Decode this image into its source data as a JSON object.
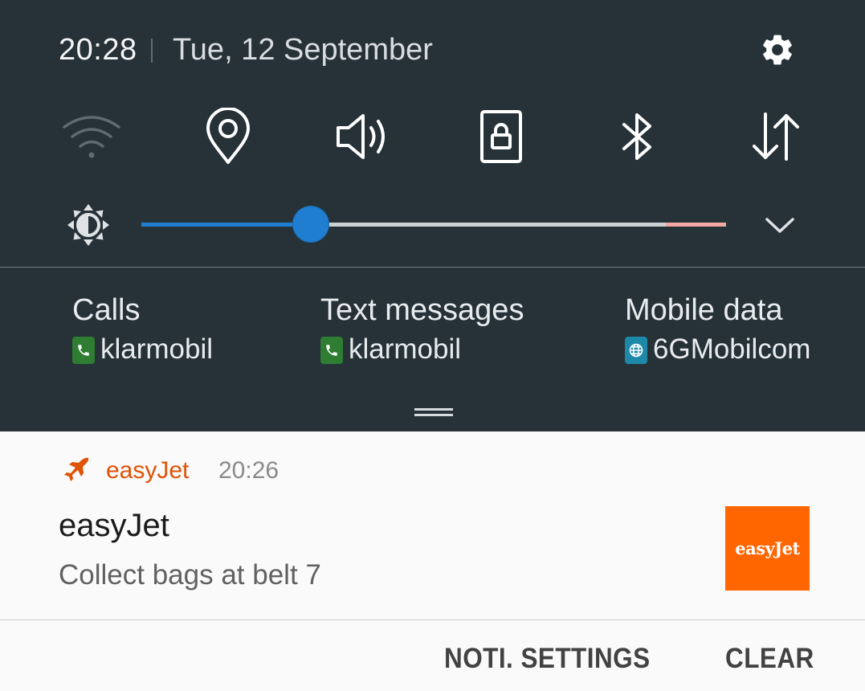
{
  "status": {
    "time": "20:28",
    "date": "Tue, 12 September"
  },
  "quick_settings": [
    {
      "icon": "wifi-icon",
      "active": false
    },
    {
      "icon": "location-icon",
      "active": true
    },
    {
      "icon": "sound-icon",
      "active": true
    },
    {
      "icon": "screen-rotation-lock-icon",
      "active": true
    },
    {
      "icon": "bluetooth-icon",
      "active": true
    },
    {
      "icon": "mobile-data-icon",
      "active": true
    }
  ],
  "brightness": {
    "level": 0.29
  },
  "sim": [
    {
      "title": "Calls",
      "carrier": "klarmobil",
      "icon": "phone-icon",
      "color": "#2e7d32"
    },
    {
      "title": "Text messages",
      "carrier": "klarmobil",
      "icon": "phone-icon",
      "color": "#2e7d32"
    },
    {
      "title": "Mobile data",
      "carrier": "6GMobilcom",
      "icon": "globe-icon",
      "color": "#1e88a8"
    }
  ],
  "notification": {
    "app_name": "easyJet",
    "time": "20:26",
    "title": "easyJet",
    "text": "Collect bags at belt 7",
    "thumbnail_text": "easyJet",
    "brand_color": "#ff6600"
  },
  "actions": {
    "settings_label": "NOTI. SETTINGS",
    "clear_label": "CLEAR"
  }
}
